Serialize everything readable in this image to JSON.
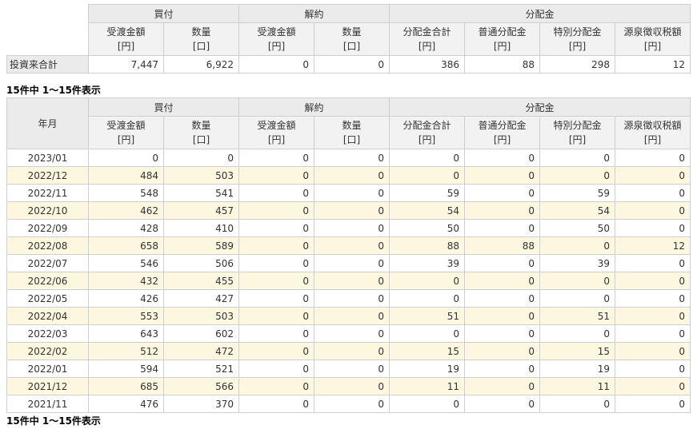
{
  "header": {
    "groups": {
      "buy": "買付",
      "cancel": "解約",
      "dist": "分配金"
    },
    "cols": [
      {
        "name": "受渡金額",
        "unit": "[円]"
      },
      {
        "name": "数量",
        "unit": "[口]"
      },
      {
        "name": "受渡金額",
        "unit": "[円]"
      },
      {
        "name": "数量",
        "unit": "[口]"
      },
      {
        "name": "分配金合計",
        "unit": "[円]"
      },
      {
        "name": "普通分配金",
        "unit": "[円]"
      },
      {
        "name": "特別分配金",
        "unit": "[円]"
      },
      {
        "name": "源泉徴収税額",
        "unit": "[円]"
      }
    ],
    "year_month": "年月"
  },
  "summary": {
    "label": "投資来合計",
    "values": [
      "7,447",
      "6,922",
      "0",
      "0",
      "386",
      "88",
      "298",
      "12"
    ]
  },
  "pager": {
    "top": "15件中 1～15件表示",
    "bottom": "15件中 1～15件表示"
  },
  "rows": [
    {
      "ym": "2023/01",
      "v": [
        "0",
        "0",
        "0",
        "0",
        "0",
        "0",
        "0",
        "0"
      ]
    },
    {
      "ym": "2022/12",
      "v": [
        "484",
        "503",
        "0",
        "0",
        "0",
        "0",
        "0",
        "0"
      ]
    },
    {
      "ym": "2022/11",
      "v": [
        "548",
        "541",
        "0",
        "0",
        "59",
        "0",
        "59",
        "0"
      ]
    },
    {
      "ym": "2022/10",
      "v": [
        "462",
        "457",
        "0",
        "0",
        "54",
        "0",
        "54",
        "0"
      ]
    },
    {
      "ym": "2022/09",
      "v": [
        "428",
        "410",
        "0",
        "0",
        "50",
        "0",
        "50",
        "0"
      ]
    },
    {
      "ym": "2022/08",
      "v": [
        "658",
        "589",
        "0",
        "0",
        "88",
        "88",
        "0",
        "12"
      ]
    },
    {
      "ym": "2022/07",
      "v": [
        "546",
        "506",
        "0",
        "0",
        "39",
        "0",
        "39",
        "0"
      ]
    },
    {
      "ym": "2022/06",
      "v": [
        "432",
        "455",
        "0",
        "0",
        "0",
        "0",
        "0",
        "0"
      ]
    },
    {
      "ym": "2022/05",
      "v": [
        "426",
        "427",
        "0",
        "0",
        "0",
        "0",
        "0",
        "0"
      ]
    },
    {
      "ym": "2022/04",
      "v": [
        "553",
        "503",
        "0",
        "0",
        "51",
        "0",
        "51",
        "0"
      ]
    },
    {
      "ym": "2022/03",
      "v": [
        "643",
        "602",
        "0",
        "0",
        "0",
        "0",
        "0",
        "0"
      ]
    },
    {
      "ym": "2022/02",
      "v": [
        "512",
        "472",
        "0",
        "0",
        "15",
        "0",
        "15",
        "0"
      ]
    },
    {
      "ym": "2022/01",
      "v": [
        "594",
        "521",
        "0",
        "0",
        "19",
        "0",
        "19",
        "0"
      ]
    },
    {
      "ym": "2021/12",
      "v": [
        "685",
        "566",
        "0",
        "0",
        "11",
        "0",
        "11",
        "0"
      ]
    },
    {
      "ym": "2021/11",
      "v": [
        "476",
        "370",
        "0",
        "0",
        "0",
        "0",
        "0",
        "0"
      ]
    }
  ]
}
